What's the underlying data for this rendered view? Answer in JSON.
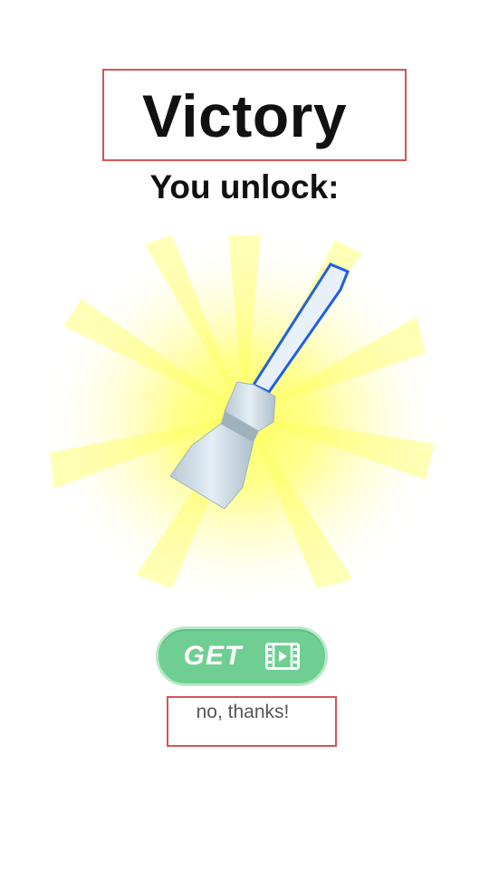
{
  "title": "Victory",
  "subtitle": "You unlock:",
  "reward": {
    "item_icon": "lightsaber-icon",
    "blade_color": "#1f5fe0",
    "glow_color": "#ffff6e"
  },
  "get_button": {
    "label": "GET",
    "icon": "video-ad-icon",
    "color": "#6fcf92"
  },
  "no_thanks": {
    "label": "no, thanks!"
  }
}
